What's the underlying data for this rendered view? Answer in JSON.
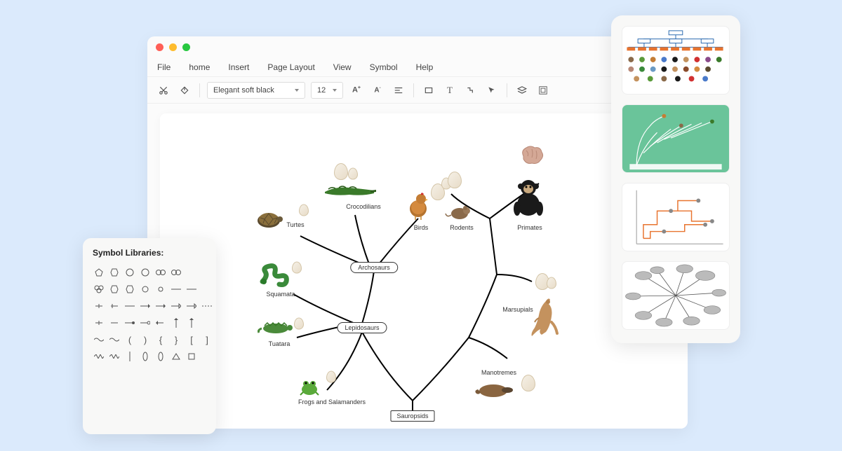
{
  "menu": {
    "items": [
      "File",
      "home",
      "Insert",
      "Page Layout",
      "View",
      "Symbol",
      "Help"
    ]
  },
  "toolbar": {
    "font_name": "Elegant soft black",
    "font_size": "12"
  },
  "palette": {
    "title": "Symbol Libraries:"
  },
  "diagram": {
    "nodes": {
      "sauropsids": "Sauropsids",
      "lepidosaurs": "Lepidosaurs",
      "archosaurs": "Archosaurs"
    },
    "labels": {
      "turtles": "Turtes",
      "crocodilians": "Crocodilians",
      "birds": "Birds",
      "rodents": "Rodents",
      "primates": "Primates",
      "squamata": "Squamata",
      "tuatara": "Tuatara",
      "frogs": "Frogs and Salamanders",
      "marsupials": "Marsupials",
      "monotremes": "Manotremes"
    }
  }
}
